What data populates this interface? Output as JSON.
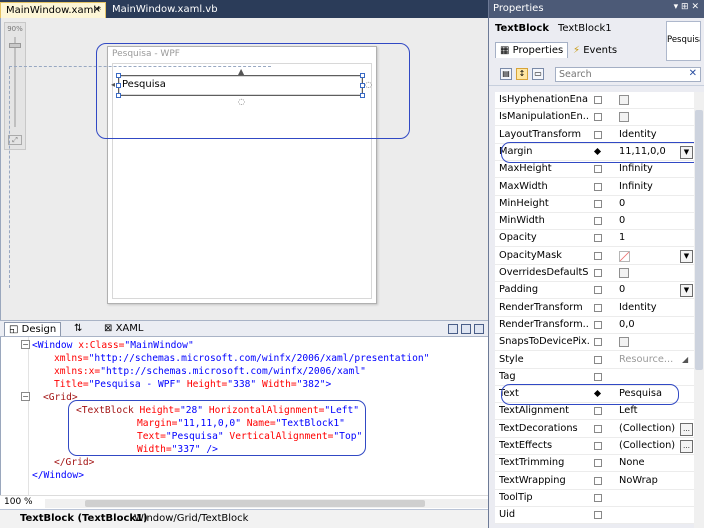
{
  "tabs": [
    {
      "label": "MainWindow.xaml*"
    },
    {
      "label": "MainWindow.xaml.vb"
    }
  ],
  "tab_close": "×",
  "designer": {
    "window_title": "Pesquisa - WPF",
    "textblock_text": "Pesquisa",
    "zoom_label": "90%"
  },
  "split": {
    "design": "Design",
    "swap": "⇅",
    "xaml": "XAML"
  },
  "code": {
    "line1_tag": "<Window",
    "line1_attr": " x:Class=",
    "line1_val": "\"MainWindow\"",
    "line2_attr": "xmlns=",
    "line2_val": "\"http://schemas.microsoft.com/winfx/2006/xaml/presentation\"",
    "line3_attr": "xmlns:x=",
    "line3_val": "\"http://schemas.microsoft.com/winfx/2006/xaml\"",
    "line4_attr1": "Title=",
    "line4_val1": "\"Pesquisa - WPF\"",
    "line4_attr2": " Height=",
    "line4_val2": "\"338\"",
    "line4_attr3": " Width=",
    "line4_val3": "\"382\"",
    "line4_end": ">",
    "line5": "<Grid>",
    "line6_tag": "<TextBlock",
    "line6_attr1": " Height=",
    "line6_val1": "\"28\"",
    "line6_attr2": " HorizontalAlignment=",
    "line6_val2": "\"Left\"",
    "line7_attr1": "Margin=",
    "line7_val1": "\"11,11,0,0\"",
    "line7_attr2": " Name=",
    "line7_val2": "\"TextBlock1\"",
    "line8_attr1": "Text=",
    "line8_val1": "\"Pesquisa\"",
    "line8_attr2": " VerticalAlignment=",
    "line8_val2": "\"Top\"",
    "line9_attr": "Width=",
    "line9_val": "\"337\"",
    "line9_end": " />",
    "line10": "</Grid>",
    "line11": "</Window>"
  },
  "editor_zoom": "100 %",
  "breadcrumb": {
    "element": "TextBlock (TextBlock1)",
    "path": "Window/Grid/TextBlock"
  },
  "properties": {
    "title": "Properties",
    "title_buttons": "▾ ⊞ ✕",
    "object_type": "TextBlock",
    "object_name": "TextBlock1",
    "preview_text": "Pesquisa",
    "tab_properties": "Properties",
    "tab_events": "Events",
    "search_placeholder": "Search",
    "search_clear": "✕",
    "rows": [
      {
        "name": "IsHyphenationEna...",
        "value": ""
      },
      {
        "name": "IsManipulationEn...",
        "value": ""
      },
      {
        "name": "LayoutTransform",
        "value": "Identity"
      },
      {
        "name": "Margin",
        "value": "11,11,0,0"
      },
      {
        "name": "MaxHeight",
        "value": "Infinity"
      },
      {
        "name": "MaxWidth",
        "value": "Infinity"
      },
      {
        "name": "MinHeight",
        "value": "0"
      },
      {
        "name": "MinWidth",
        "value": "0"
      },
      {
        "name": "Opacity",
        "value": "1"
      },
      {
        "name": "OpacityMask",
        "value": ""
      },
      {
        "name": "OverridesDefaultS...",
        "value": ""
      },
      {
        "name": "Padding",
        "value": "0"
      },
      {
        "name": "RenderTransform",
        "value": "Identity"
      },
      {
        "name": "RenderTransform...",
        "value": "0,0"
      },
      {
        "name": "SnapsToDevicePix...",
        "value": ""
      },
      {
        "name": "Style",
        "value": "Resource..."
      },
      {
        "name": "Tag",
        "value": ""
      },
      {
        "name": "Text",
        "value": "Pesquisa"
      },
      {
        "name": "TextAlignment",
        "value": "Left"
      },
      {
        "name": "TextDecorations",
        "value": "(Collection)"
      },
      {
        "name": "TextEffects",
        "value": "(Collection)"
      },
      {
        "name": "TextTrimming",
        "value": "None"
      },
      {
        "name": "TextWrapping",
        "value": "NoWrap"
      },
      {
        "name": "ToolTip",
        "value": ""
      },
      {
        "name": "Uid",
        "value": ""
      }
    ]
  }
}
